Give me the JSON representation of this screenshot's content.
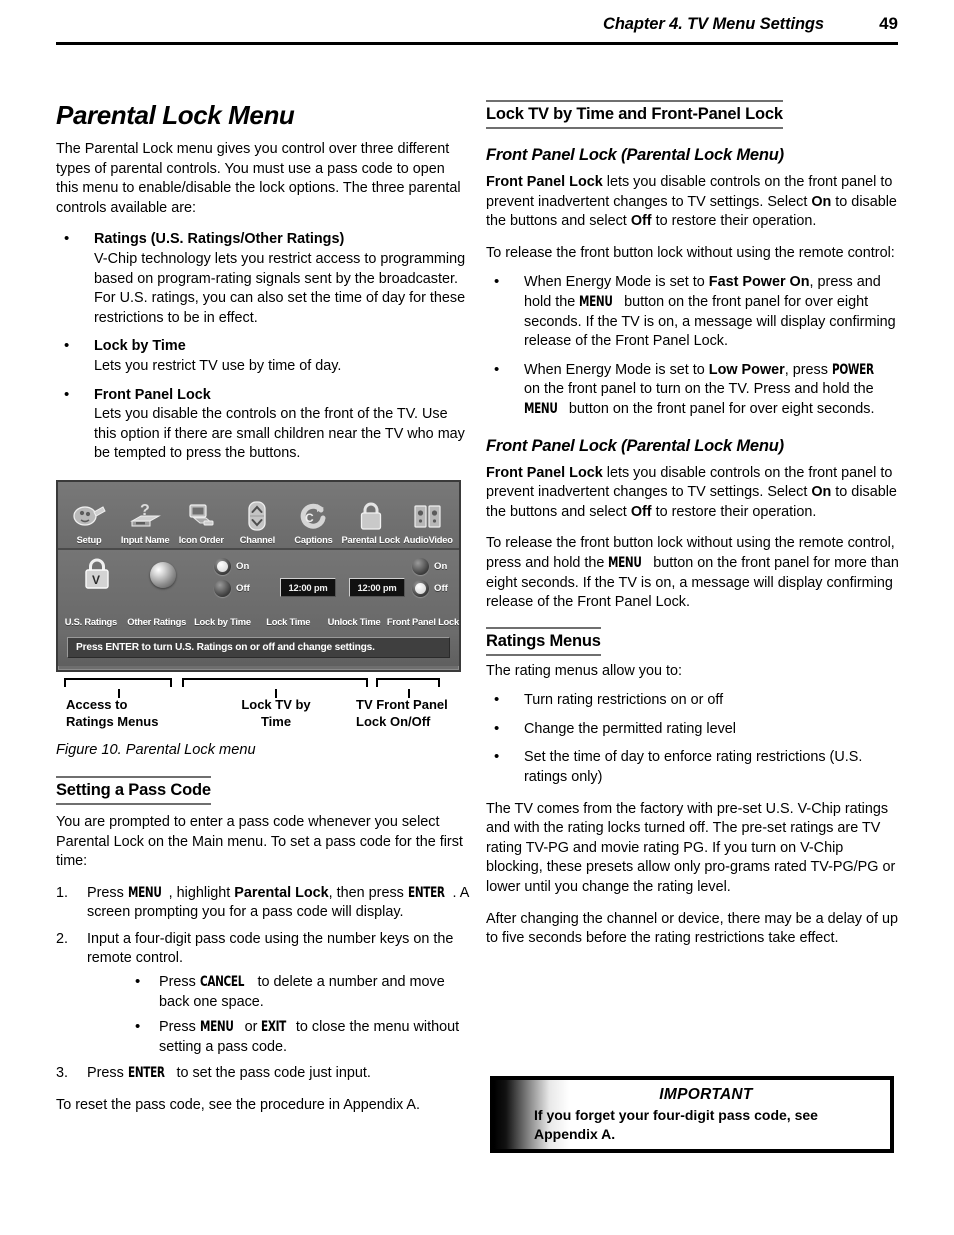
{
  "header": {
    "chapter_title": "Chapter 4. TV Menu Settings",
    "page_number": "49"
  },
  "left_column": {
    "title": "Parental Lock Menu",
    "intro": "The Parental Lock menu gives you control over three different types of parental controls.  You must use a pass code to open this menu to enable/disable the lock options.  The three parental controls available are:",
    "bullets": [
      {
        "title": "Ratings (U.S. Ratings/Other Ratings)",
        "text": "V-Chip technology lets you restrict access to programming based on program-rating signals sent by the broadcaster.  For U.S. ratings, you can also set the time of day for these restrictions to be in effect."
      },
      {
        "title": "Lock by Time",
        "text": "Lets you restrict TV use by time of day."
      },
      {
        "title": "Front Panel Lock",
        "text": "Lets you disable the controls on the front of the TV.  Use this option if there are small children near the TV who may be tempted to press the buttons."
      }
    ],
    "figure": {
      "icon_bar": [
        {
          "label": "Setup",
          "icon": "plug-icon"
        },
        {
          "label": "Input Name",
          "icon": "question-device-icon"
        },
        {
          "label": "Icon Order",
          "icon": "monitor-icon"
        },
        {
          "label": "Channel",
          "icon": "up-down-arrows-icon"
        },
        {
          "label": "Captions",
          "icon": "cc-circular-arrow-icon"
        },
        {
          "label": "Parental Lock",
          "icon": "padlock-icon"
        },
        {
          "label": "AudioVideo",
          "icon": "speakers-icon"
        }
      ],
      "control_labels": [
        "U.S. Ratings",
        "Other Ratings",
        "Lock by Time",
        "Lock Time",
        "Unlock Time",
        "Front Panel Lock"
      ],
      "lock_by_time": {
        "on_label": "On",
        "off_label": "Off",
        "selected": "On"
      },
      "front_panel_lock": {
        "on_label": "On",
        "off_label": "Off",
        "selected": "Off"
      },
      "lock_time_value": "12:00 pm",
      "unlock_time_value": "12:00 pm",
      "hint_bar": "Press ENTER to turn U.S. Ratings on or off and change settings.",
      "callouts": [
        "Access to\nRatings Menus",
        "Lock TV by\nTime",
        "TV Front Panel\nLock On/Off"
      ],
      "callout_1_line1": "Access to",
      "callout_1_line2": "Ratings Menus",
      "callout_2_line1": "Lock TV by",
      "callout_2_line2": "Time",
      "callout_3_line1": "TV Front Panel",
      "callout_3_line2": "Lock On/Off",
      "caption": "Figure 10.  Parental Lock menu"
    },
    "pass_code_section": {
      "heading": "Setting a Pass Code",
      "intro": "You are prompted to enter a pass code whenever you select Parental Lock on the Main menu.  To set a pass code for the first time:",
      "step1_a": "Press ",
      "step1_key1": "MENU",
      "step1_b": ", highlight ",
      "step1_bold": "Parental Lock",
      "step1_c": ", then press ",
      "step1_key2": "ENTER",
      "step1_d": ".  A screen prompting you for a pass code will display.",
      "step2": "Input a four-digit pass code using the number keys on the remote control.",
      "sub1_a": "Press ",
      "sub1_key": "CANCEL",
      "sub1_b": " to delete a number and move back one space.",
      "sub2_a": "Press ",
      "sub2_key1": "MENU",
      "sub2_b": " or ",
      "sub2_key2": "EXIT",
      "sub2_c": " to close the menu without setting a pass code.",
      "step3_a": "Press ",
      "step3_key": "ENTER",
      "step3_b": " to set the pass code just input.",
      "closing": "To reset the pass code, see the procedure in Appendix A."
    }
  },
  "right_column": {
    "section_heading": "Lock TV by Time and Front-Panel Lock",
    "sub_heading_1": "Front Panel Lock (Parental Lock Menu)",
    "para_1_bold": "Front Panel Lock",
    "para_1_a": " lets you disable controls on the front panel to prevent inadvertent changes to TV settings.  Select ",
    "para_1_on": "On",
    "para_1_b": " to disable the buttons and select ",
    "para_1_off": "Off",
    "para_1_c": " to restore their operation.",
    "para_2": "To release the front button lock without using the remote control:",
    "bullet_1_a": "When Energy Mode is set to ",
    "bullet_1_bold": "Fast Power On",
    "bullet_1_b": ", press and hold the ",
    "bullet_1_key": "MENU",
    "bullet_1_c": " button on the front panel for over eight seconds.  If the TV is on, a message will display confirming release of the Front Panel Lock.",
    "bullet_2_a": "When Energy Mode is set to ",
    "bullet_2_bold": "Low Power",
    "bullet_2_b": ", press ",
    "bullet_2_key1": "POWER",
    "bullet_2_c": " on the front panel to turn on the TV.  Press and hold the ",
    "bullet_2_key2": "MENU",
    "bullet_2_d": " button on the front panel for over eight seconds.",
    "sub_heading_2": "Front Panel Lock (Parental Lock Menu)",
    "para_3_bold": "Front Panel Lock",
    "para_3_a": " lets you disable controls on the front panel to prevent inadvertent changes to TV settings.  Select ",
    "para_3_on": "On",
    "para_3_b": " to disable the buttons and select ",
    "para_3_off": "Off",
    "para_3_c": " to restore their operation.",
    "para_4_a": "To release the front button lock without using the remote control, press and hold the ",
    "para_4_key": "MENU",
    "para_4_b": " button on the front panel for more than eight seconds.  If the TV is on, a message will display confirming release of the Front Panel Lock.",
    "ratings_heading": "Ratings Menus",
    "ratings_intro": "The rating menus allow you to:",
    "ratings_bullets": [
      "Turn rating restrictions on or off",
      "Change the permitted rating level",
      "Set the time of day to enforce rating restrictions (U.S. ratings only)"
    ],
    "ratings_para_1": "The TV comes from the factory with pre-set U.S. V-Chip ratings and with the rating locks turned off.  The pre-set ratings are TV rating TV-PG and movie rating PG.  If you turn on V-Chip blocking, these presets allow only pro-grams rated TV-PG/PG or lower until you change the rating level.",
    "ratings_para_2": "After changing the channel or device, there may be a delay of up to five seconds before the rating restrictions take effect."
  },
  "important_box": {
    "title": "IMPORTANT",
    "body": "If you forget your four-digit pass code, see Appendix A."
  }
}
